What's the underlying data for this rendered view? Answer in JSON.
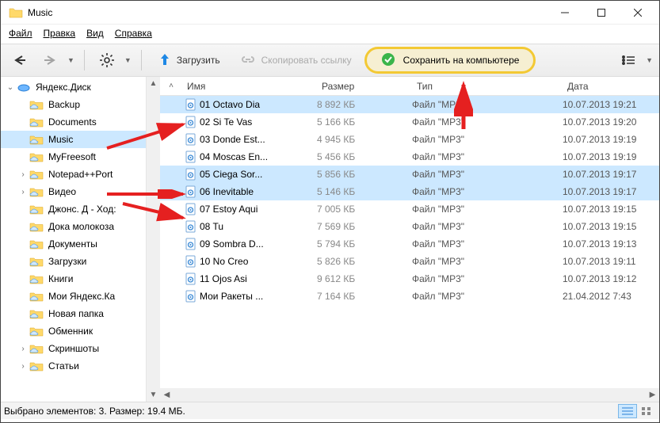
{
  "window": {
    "title": "Music"
  },
  "menu": {
    "file": "Файл",
    "edit": "Правка",
    "view": "Вид",
    "help": "Справка"
  },
  "toolbar": {
    "upload": "Загрузить",
    "copylink": "Скопировать ссылку",
    "save": "Сохранить на компьютере"
  },
  "sidebar": {
    "root": "Яндекс.Диск",
    "items": [
      {
        "label": "Backup",
        "expandable": false
      },
      {
        "label": "Documents",
        "expandable": false
      },
      {
        "label": "Music",
        "selected": true,
        "expandable": false
      },
      {
        "label": "MyFreesoft",
        "expandable": false
      },
      {
        "label": "Notepad++Port",
        "expandable": true
      },
      {
        "label": "Видео",
        "expandable": true
      },
      {
        "label": "Джонс. Д - Ход:",
        "expandable": false
      },
      {
        "label": "Дока молокоза",
        "expandable": false
      },
      {
        "label": "Документы",
        "expandable": false
      },
      {
        "label": "Загрузки",
        "expandable": false
      },
      {
        "label": "Книги",
        "expandable": false
      },
      {
        "label": "Мои Яндекс.Ка",
        "expandable": false
      },
      {
        "label": "Новая папка",
        "expandable": false
      },
      {
        "label": "Обменник",
        "expandable": false
      },
      {
        "label": "Скриншоты",
        "expandable": true
      },
      {
        "label": "Статьи",
        "expandable": true
      }
    ]
  },
  "columns": {
    "name": "Имя",
    "size": "Размер",
    "type": "Тип",
    "date": "Дата"
  },
  "files": [
    {
      "name": "01 Octavo Dia",
      "size": "8 892 КБ",
      "type": "Файл \"MP3\"",
      "date": "10.07.2013 19:21",
      "selected": true
    },
    {
      "name": "02 Si Te Vas",
      "size": "5 166 КБ",
      "type": "Файл \"MP3\"",
      "date": "10.07.2013 19:20"
    },
    {
      "name": "03 Donde Est...",
      "size": "4 945 КБ",
      "type": "Файл \"MP3\"",
      "date": "10.07.2013 19:19"
    },
    {
      "name": "04 Moscas En...",
      "size": "5 456 КБ",
      "type": "Файл \"MP3\"",
      "date": "10.07.2013 19:19"
    },
    {
      "name": "05 Ciega Sor...",
      "size": "5 856 КБ",
      "type": "Файл \"MP3\"",
      "date": "10.07.2013 19:17",
      "selected": true
    },
    {
      "name": "06 Inevitable",
      "size": "5 146 КБ",
      "type": "Файл \"MP3\"",
      "date": "10.07.2013 19:17",
      "selected": true
    },
    {
      "name": "07 Estoy Aqui",
      "size": "7 005 КБ",
      "type": "Файл \"MP3\"",
      "date": "10.07.2013 19:15"
    },
    {
      "name": "08 Tu",
      "size": "7 569 КБ",
      "type": "Файл \"MP3\"",
      "date": "10.07.2013 19:15"
    },
    {
      "name": "09 Sombra D...",
      "size": "5 794 КБ",
      "type": "Файл \"MP3\"",
      "date": "10.07.2013 19:13"
    },
    {
      "name": "10 No Creo",
      "size": "5 826 КБ",
      "type": "Файл \"MP3\"",
      "date": "10.07.2013 19:11"
    },
    {
      "name": "11 Ojos Asi",
      "size": "9 612 КБ",
      "type": "Файл \"MP3\"",
      "date": "10.07.2013 19:12"
    },
    {
      "name": "Мои Ракеты ...",
      "size": "7 164 КБ",
      "type": "Файл \"MP3\"",
      "date": "21.04.2012 7:43"
    }
  ],
  "status": "Выбрано элементов: 3. Размер: 19.4 МБ."
}
